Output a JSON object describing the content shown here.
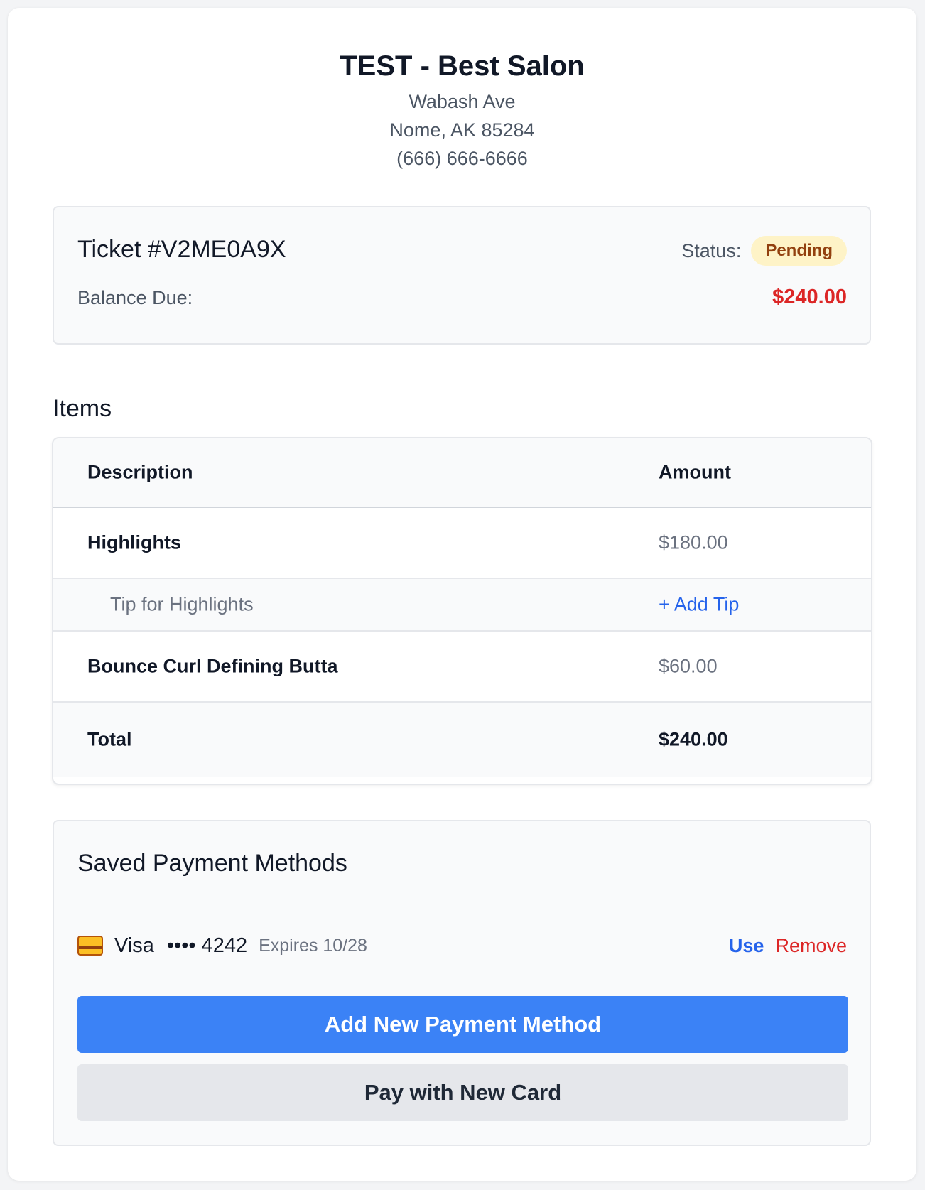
{
  "salon": {
    "name": "TEST - Best Salon",
    "address_line1": "Wabash Ave",
    "address_line2": "Nome, AK 85284",
    "phone": "(666) 666-6666"
  },
  "ticket": {
    "title": "Ticket #V2ME0A9X",
    "status_label": "Status:",
    "status": "Pending",
    "balance_label": "Balance Due:",
    "balance_value": "$240.00",
    "status_color": "#fef3c7",
    "balance_color": "#dc2626"
  },
  "items": {
    "heading": "Items",
    "columns": {
      "description": "Description",
      "amount": "Amount"
    },
    "rows": [
      {
        "description": "Highlights",
        "amount": "$180.00"
      },
      {
        "description": "Tip for Highlights",
        "amount": "+ Add Tip"
      },
      {
        "description": "Bounce Curl Defining Butta",
        "amount": "$60.00"
      }
    ],
    "total": {
      "label": "Total",
      "amount": "$240.00"
    }
  },
  "payment": {
    "heading": "Saved Payment Methods",
    "card": {
      "icon": "credit-card-icon",
      "brand": "Visa",
      "number": "•••• 4242",
      "expires": "Expires 10/28",
      "use_label": "Use",
      "remove_label": "Remove"
    },
    "add_button": "Add New Payment Method",
    "pay_button": "Pay with New Card",
    "accent_color": "#3b82f6"
  }
}
